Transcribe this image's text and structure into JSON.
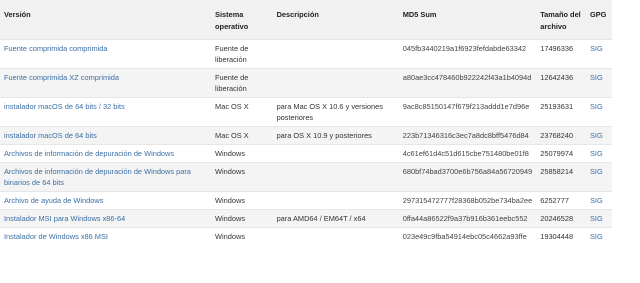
{
  "headers": {
    "version": "Versión",
    "os": "Sistema operativo",
    "description": "Descripción",
    "md5": "MD5 Sum",
    "size": "Tamaño del archivo",
    "gpg": "GPG"
  },
  "rows": [
    {
      "version": "Fuente comprimida comprimida",
      "os": "Fuente de liberación",
      "description": "",
      "md5": "045fb3440219a1f6923fefdabde63342",
      "size": "17496336",
      "gpg": "SIG"
    },
    {
      "version": "Fuente comprimida XZ comprimida",
      "os": "Fuente de liberación",
      "description": "",
      "md5": "a80ae3cc478460b922242f43a1b4094d",
      "size": "12642436",
      "gpg": "SIG"
    },
    {
      "version": "instalador macOS de 64 bits / 32 bits",
      "os": "Mac OS X",
      "description": "para Mac OS X 10.6 y versiones posteriores",
      "md5": "9ac8c85150147f679f213addd1e7d96e",
      "size": "25193631",
      "gpg": "SIG"
    },
    {
      "version": "instalador macOS de 64 bits",
      "os": "Mac OS X",
      "description": "para OS X 10.9 y posteriores",
      "md5": "223b71346316c3ec7a8dc8bff5476d84",
      "size": "23768240",
      "gpg": "SIG"
    },
    {
      "version": "Archivos de información de depuración de Windows",
      "os": "Windows",
      "description": "",
      "md5": "4c61ef61d4c51d615cbe751480be01f8",
      "size": "25079974",
      "gpg": "SIG"
    },
    {
      "version": "Archivos de información de depuración de Windows para binarios de 64 bits",
      "os": "Windows",
      "description": "",
      "md5": "680bf74bad3700e6b756a84a56720949",
      "size": "25858214",
      "gpg": "SIG"
    },
    {
      "version": "Archivo de ayuda de Windows",
      "os": "Windows",
      "description": "",
      "md5": "297315472777f28368b052be734ba2ee",
      "size": "6252777",
      "gpg": "SIG"
    },
    {
      "version": "Instalador MSI para Windows x86-64",
      "os": "Windows",
      "description": "para AMD64 / EM64T / x64",
      "md5": "0ffa44a86522f9a37b916b361eebc552",
      "size": "20246528",
      "gpg": "SIG"
    },
    {
      "version": "Instalador de Windows x86 MSI",
      "os": "Windows",
      "description": "",
      "md5": "023e49c9fba54914ebc05c4662a93ffe",
      "size": "19304448",
      "gpg": "SIG"
    }
  ]
}
